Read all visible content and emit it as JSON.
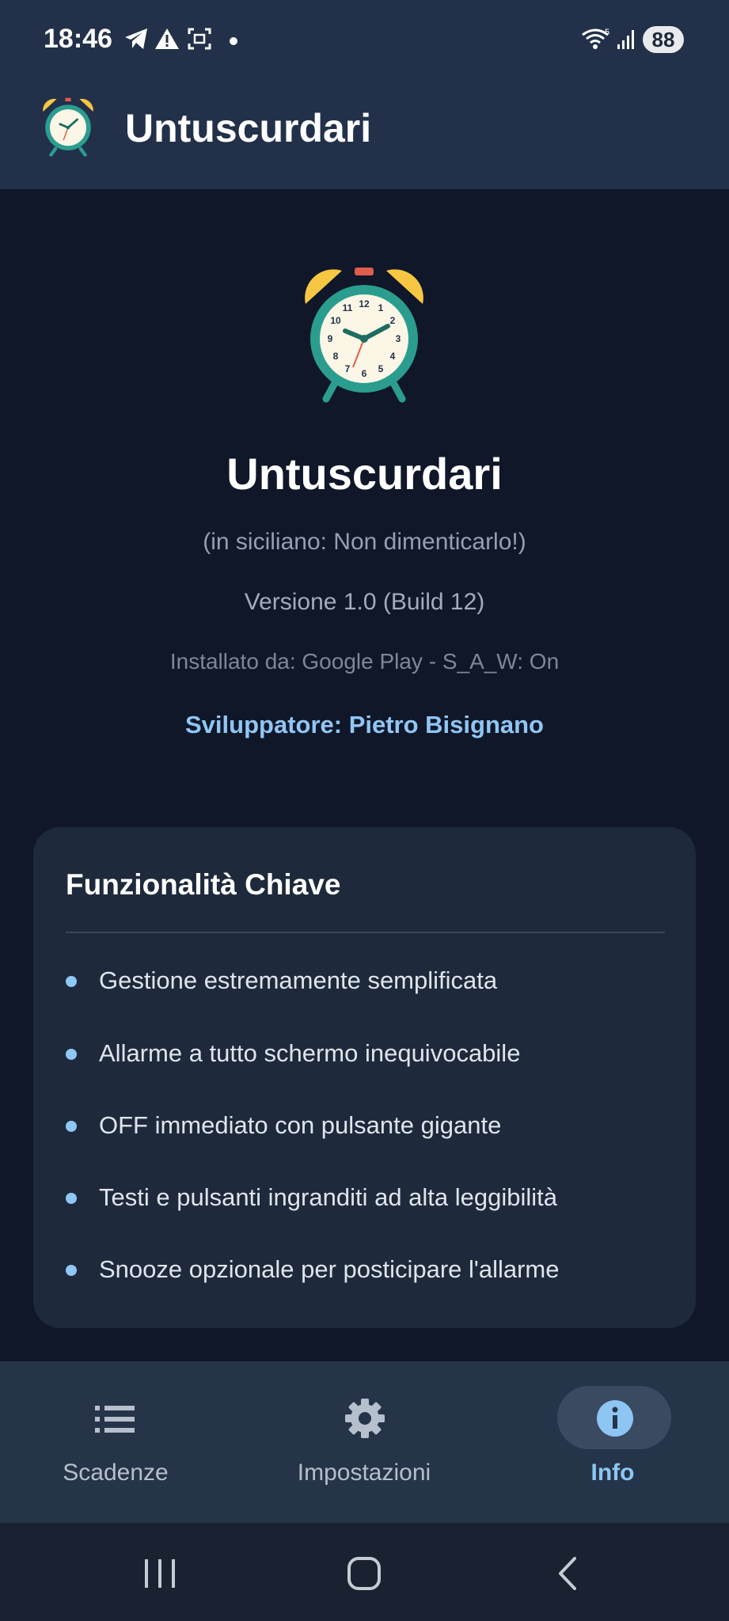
{
  "status_bar": {
    "time": "18:46",
    "battery": "88",
    "icons": [
      "telegram-icon",
      "warning-icon",
      "screenshot-icon",
      "notification-dot",
      "wifi-icon",
      "signal-icon"
    ]
  },
  "app_bar": {
    "title": "Untuscurdari",
    "icon": "alarm-clock-icon"
  },
  "about": {
    "app_name": "Untuscurdari",
    "tagline": "(in siciliano: Non dimenticarlo!)",
    "version": "Versione 1.0 (Build 12)",
    "install_info": "Installato da: Google Play - S_A_W: On",
    "developer": "Sviluppatore: Pietro Bisignano"
  },
  "features_card": {
    "title": "Funzionalità Chiave",
    "items": [
      "Gestione estremamente semplificata",
      "Allarme a tutto schermo inequivocabile",
      "OFF immediato con pulsante gigante",
      "Testi e pulsanti ingranditi ad alta leggibilità",
      "Snooze opzionale per posticipare l'allarme"
    ]
  },
  "bottom_nav": {
    "items": [
      {
        "label": "Scadenze",
        "icon": "list-icon",
        "active": false
      },
      {
        "label": "Impostazioni",
        "icon": "gear-icon",
        "active": false
      },
      {
        "label": "Info",
        "icon": "info-icon",
        "active": true
      }
    ]
  },
  "system_nav": [
    "recents-button",
    "home-button",
    "back-button"
  ],
  "colors": {
    "background": "#0f1729",
    "app_bar": "#223149",
    "card": "#1e293b",
    "accent": "#8fc7f5",
    "bottom_nav": "#263449"
  }
}
